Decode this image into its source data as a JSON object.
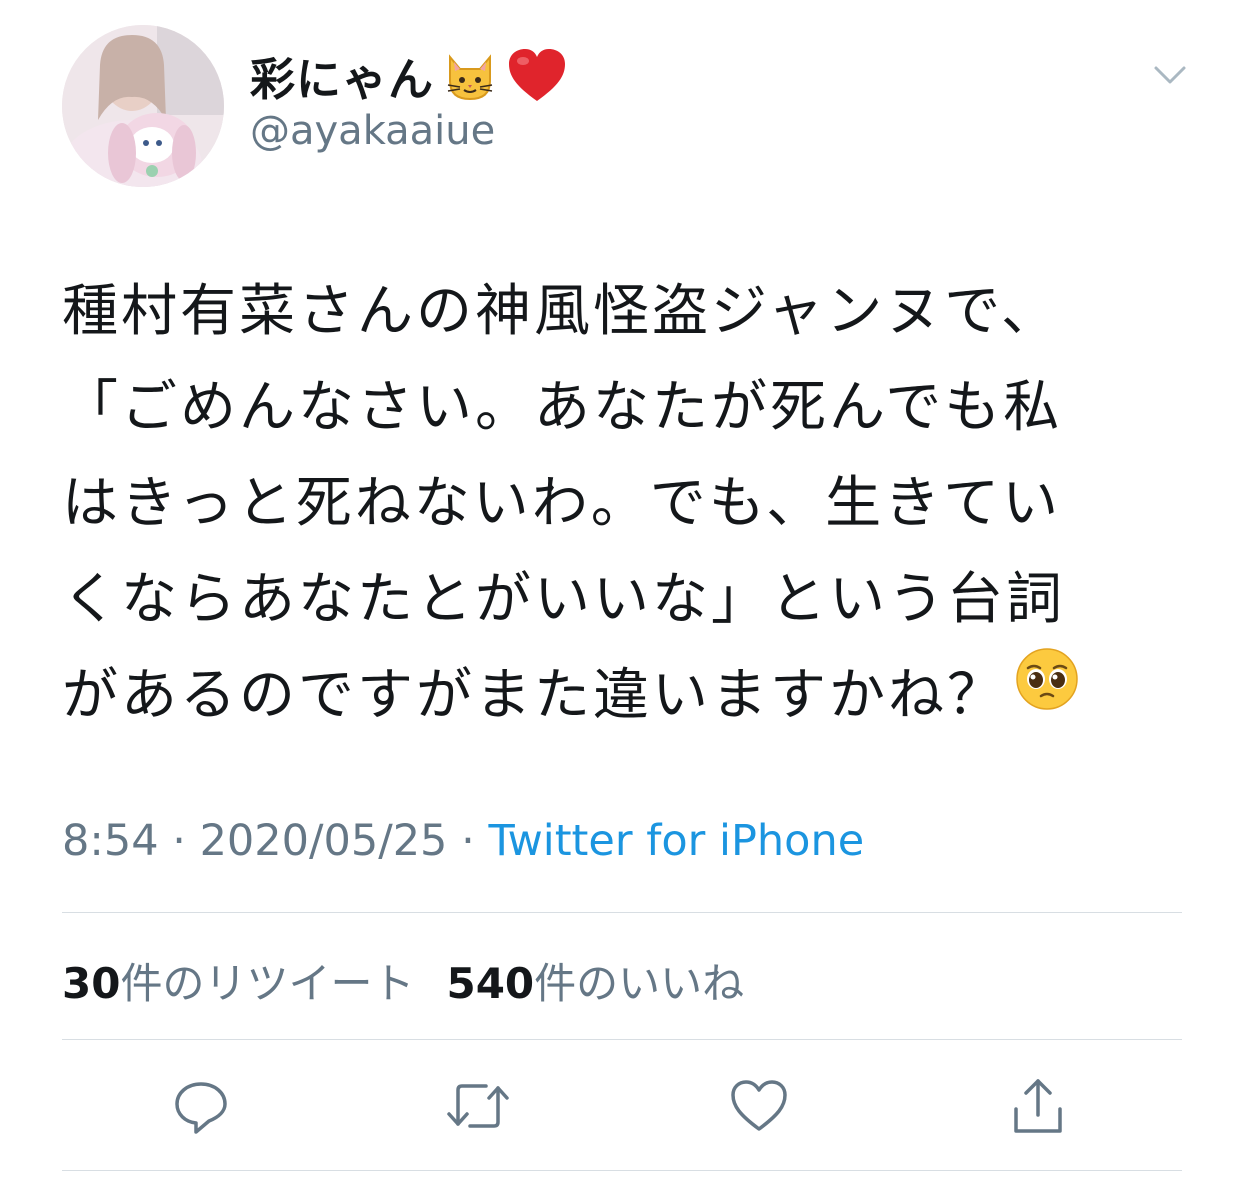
{
  "user": {
    "display_name": "彩にゃん",
    "name_emojis": [
      "cat-face-icon",
      "red-heart-icon"
    ],
    "handle": "@ayakaaiue",
    "avatar": "profile-photo"
  },
  "menu": {
    "icon": "chevron-down-icon"
  },
  "tweet": {
    "lines": [
      "種村有菜さんの神風怪盗ジャンヌで、",
      "「ごめんなさい。あなたが死んでも私",
      "はきっと死ねないわ。でも、生きてい",
      "くならあなたとがいいな」という台詞",
      "があるのですがまた違いますかね？"
    ],
    "trailing_emoji": "pleading-face-icon"
  },
  "meta": {
    "time": "8:54",
    "separator": " · ",
    "date": "2020/05/25",
    "source": "Twitter for iPhone"
  },
  "stats": {
    "retweet_count": "30",
    "retweet_label": "件のリツイート",
    "like_count": "540",
    "like_label": "件のいいね"
  },
  "actions": {
    "reply_icon": "reply-icon",
    "retweet_icon": "retweet-icon",
    "like_icon": "like-heart-icon",
    "share_icon": "share-icon"
  },
  "colors": {
    "text": "#14171a",
    "secondary": "#657786",
    "link": "#1b95e0",
    "divider": "#d8dee3",
    "background": "#ffffff"
  }
}
